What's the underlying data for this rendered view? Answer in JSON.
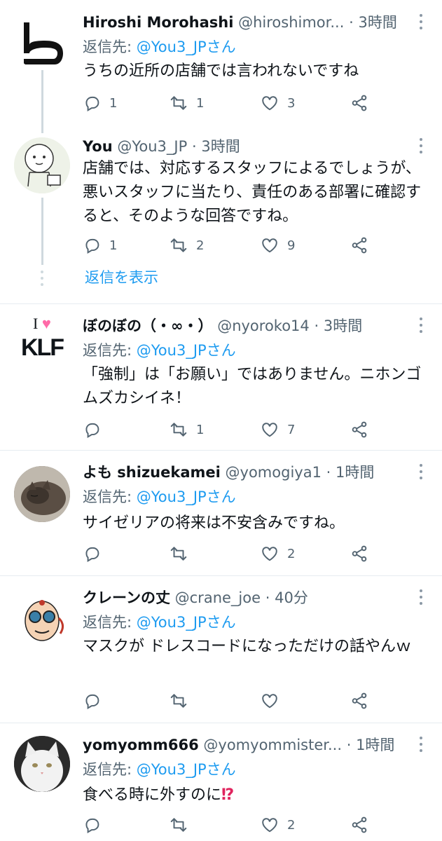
{
  "tweets": [
    {
      "name": "Hiroshi Morohashi",
      "handle": "@hiroshimor...",
      "time": "3時間",
      "reply_prefix": "返信先:",
      "reply_handle": "@You3_JPさん",
      "text": "うちの近所の店舗では言われないですね",
      "replies": "1",
      "retweets": "1",
      "likes": "3"
    },
    {
      "name": "You",
      "handle": "@You3_JP",
      "time": "3時間",
      "text": "店舗では、対応するスタッフによるでしょうが、悪いスタッフに当たり、責任のある部署に確認すると、そのような回答ですね。",
      "replies": "1",
      "retweets": "2",
      "likes": "9",
      "show_replies": "返信を表示"
    },
    {
      "name": "ぼのぼの（・∞・）",
      "handle": "@nyoroko14",
      "time": "3時間",
      "reply_prefix": "返信先:",
      "reply_handle": "@You3_JPさん",
      "text": "「強制」は「お願い」ではありません。ニホンゴムズカシイネ！",
      "replies": "",
      "retweets": "1",
      "likes": "7",
      "avatar_text_top": "I",
      "avatar_text_bottom": "KLF"
    },
    {
      "name": "よも shizuekamei",
      "handle": "@yomogiya1",
      "time": "1時間",
      "reply_prefix": "返信先:",
      "reply_handle": "@You3_JPさん",
      "text": "サイゼリアの将来は不安含みですね。",
      "replies": "",
      "retweets": "",
      "likes": "2"
    },
    {
      "name": "クレーンの丈",
      "handle": "@crane_joe",
      "time": "40分",
      "reply_prefix": "返信先:",
      "reply_handle": "@You3_JPさん",
      "text": "マスクが ドレスコードになっただけの話やんｗ",
      "replies": "",
      "retweets": "",
      "likes": ""
    },
    {
      "name": "yomyomm666",
      "handle": "@yomyommister...",
      "time": "1時間",
      "reply_prefix": "返信先:",
      "reply_handle": "@You3_JPさん",
      "text": "食べる時に外すのに",
      "text_emoji": "⁉",
      "replies": "",
      "retweets": "",
      "likes": "2"
    }
  ],
  "separator": "·",
  "icons": [
    "reply-icon",
    "retweet-icon",
    "like-icon",
    "share-icon",
    "more-icon"
  ],
  "colors": {
    "link": "#1d9bf0",
    "muted": "#536471",
    "text": "#0f1419",
    "divider": "#e6ecf0"
  }
}
